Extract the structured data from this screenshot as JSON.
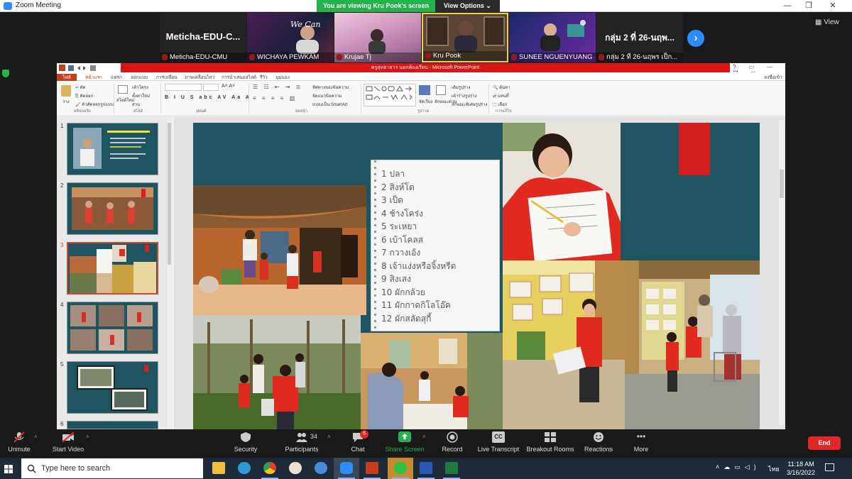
{
  "window": {
    "title": "Zoom Meeting",
    "minimize": "—",
    "maximize": "❐",
    "close": "✕"
  },
  "share_banner": "You are viewing Kru Pook's screen",
  "view_options": "View Options ⌄",
  "view_button": "View",
  "participants": [
    {
      "big": "Meticha-EDU-C...",
      "name": "Meticha-EDU-CMU"
    },
    {
      "name": "WICHAYA PEWKAM"
    },
    {
      "name": "Krujae Tj"
    },
    {
      "name": "Kru Pook"
    },
    {
      "name": "SUNEE NGUENYUANG"
    },
    {
      "big": "กลุ่ม 2 ที่ 26-นฤพ...",
      "name": "กลุ่ม 2 ที่ 26-นฤพร เป็ก..."
    }
  ],
  "ppt": {
    "title": "ครูสุทธาสาร นอกห้องเรียน - Microsoft PowerPoint",
    "tabs": [
      "ไฟล์",
      "หน้าแรก",
      "แทรก",
      "ออกแบบ",
      "การเปลี่ยน",
      "ภาพเคลื่อนไหว",
      "การนำเสนอสไลด์",
      "รีวิว",
      "มุมมอง"
    ],
    "signin": "ลงชื่อเข้าใช้",
    "ribbon_groups": [
      "คลิปบอร์ด",
      "สไลด์",
      "ฟอนต์",
      "ย่อหน้า",
      "รูปวาด",
      "การแก้ไข"
    ],
    "ribbon_buttons": {
      "paste": "วาง",
      "cut": "ตัด",
      "copy": "คัดลอก",
      "format": "ตัวคัดลอกรูปแบบ",
      "new_slide": "สไลด์ใหม่",
      "layout": "เค้าโครง",
      "reset": "ตั้งค่าใหม่",
      "section": "ส่วน",
      "find": "ค้นหา",
      "replace": "แทนที่",
      "select": "เลือก",
      "text_dir": "ทิศทางของข้อความ",
      "align_text": "จัดแนวข้อความ",
      "smartart": "แปลงเป็น SmartArt",
      "arrange": "จัดเรียง",
      "quick_styles": "ลักษณะด่วน",
      "shape_fill": "เติมรูปร่าง",
      "shape_outline": "เค้าร่างรูปร่าง",
      "shape_effects": "ลักษณะพิเศษรูปร่าง"
    },
    "slide_numbers": [
      "1",
      "2",
      "3",
      "4",
      "5",
      "6"
    ],
    "selected_slide": 3,
    "notebook_lines": [
      "1 ปลา",
      "2 สิงห์โต",
      "3 เป็ด",
      "4 ช้างโคร่ง",
      "5 ระเหยา",
      "6 เบ้าโคลส",
      "7 กวางเอ้ง",
      "8 เจ้าแง่งหรือจิ้งหรีด",
      "9 สิงเสง",
      "10 ผักกล้วย",
      "11 ผักกาดกิโลโอ๊ค",
      "12 ผักสลัดสุกี้"
    ]
  },
  "controls": [
    {
      "label": "Unmute",
      "icon": "mic-muted-icon"
    },
    {
      "label": "Start Video",
      "icon": "video-off-icon"
    },
    {
      "label": "Security",
      "icon": "shield-icon"
    },
    {
      "label": "Participants",
      "icon": "people-icon",
      "count": "34"
    },
    {
      "label": "Chat",
      "icon": "chat-icon",
      "badge": "5"
    },
    {
      "label": "Share Screen",
      "icon": "share-screen-icon"
    },
    {
      "label": "Record",
      "icon": "record-icon"
    },
    {
      "label": "Live Transcript",
      "icon": "cc-icon",
      "icon_text": "CC"
    },
    {
      "label": "Breakout Rooms",
      "icon": "breakout-rooms-icon"
    },
    {
      "label": "Reactions",
      "icon": "reactions-icon"
    },
    {
      "label": "More",
      "icon": "more-icon",
      "icon_text": "•••"
    }
  ],
  "end_button": "End",
  "taskbar": {
    "search_placeholder": "Type here to search",
    "language": "ไทย",
    "time": "11:18 AM",
    "date": "3/16/2022",
    "apps": [
      "file-explorer",
      "edge",
      "chrome",
      "paint",
      "browser",
      "zoom",
      "powerpoint",
      "line",
      "word",
      "excel"
    ]
  },
  "colors": {
    "zoom_green": "#24b24b",
    "zoom_blue": "#2d8cff",
    "ppt_red": "#d81515",
    "end_red": "#e02828",
    "slide_bg": "#1e5560"
  }
}
